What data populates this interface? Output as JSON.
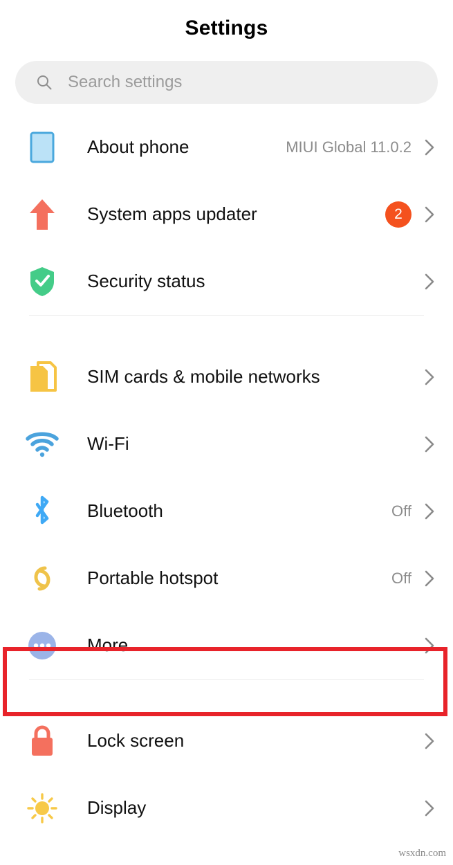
{
  "header": {
    "title": "Settings"
  },
  "search": {
    "icon": "search-icon",
    "placeholder": "Search settings",
    "value": ""
  },
  "groups": [
    {
      "id": "group-system",
      "items": [
        {
          "key": "about-phone",
          "label": "About phone",
          "value": "MIUI Global 11.0.2",
          "badge": "",
          "icon": "phone-icon",
          "icon_color": "#8ECBF0",
          "chevron": true
        },
        {
          "key": "system-apps-updater",
          "label": "System apps updater",
          "value": "",
          "badge": "2",
          "icon": "up-arrow-icon",
          "icon_color": "#F4705E",
          "chevron": true
        },
        {
          "key": "security-status",
          "label": "Security status",
          "value": "",
          "badge": "",
          "icon": "shield-check-icon",
          "icon_color": "#44CC88",
          "chevron": true
        }
      ]
    },
    {
      "id": "group-connectivity",
      "items": [
        {
          "key": "sim-cards",
          "label": "SIM cards & mobile networks",
          "value": "",
          "badge": "",
          "icon": "sim-card-icon",
          "icon_color": "#F6C444",
          "chevron": true
        },
        {
          "key": "wifi",
          "label": "Wi-Fi",
          "value": "",
          "badge": "",
          "icon": "wifi-icon",
          "icon_color": "#4BA3DD",
          "chevron": true
        },
        {
          "key": "bluetooth",
          "label": "Bluetooth",
          "value": "Off",
          "badge": "",
          "icon": "bluetooth-icon",
          "icon_color": "#3FA9F5",
          "chevron": true
        },
        {
          "key": "portable-hotspot",
          "label": "Portable hotspot",
          "value": "Off",
          "badge": "",
          "icon": "hotspot-icon",
          "icon_color": "#EFC34A",
          "chevron": true
        },
        {
          "key": "more",
          "label": "More",
          "value": "",
          "badge": "",
          "icon": "more-dots-icon",
          "icon_color": "#9BB4E8",
          "chevron": true,
          "highlighted": true
        }
      ]
    },
    {
      "id": "group-device",
      "items": [
        {
          "key": "lock-screen",
          "label": "Lock screen",
          "value": "",
          "badge": "",
          "icon": "lock-icon",
          "icon_color": "#F4705E",
          "chevron": true
        },
        {
          "key": "display",
          "label": "Display",
          "value": "",
          "badge": "",
          "icon": "sun-icon",
          "icon_color": "#F7C948",
          "chevron": true
        }
      ]
    }
  ],
  "annotation": {
    "type": "red-highlight-rectangle",
    "target": "More",
    "color": "#E8232A"
  },
  "watermark": {
    "text": "wsxdn.com"
  }
}
